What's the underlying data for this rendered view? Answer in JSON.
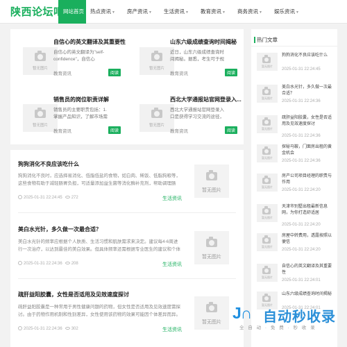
{
  "header": {
    "logo": "陕西论坛吧",
    "nav": [
      {
        "label": "网站首页",
        "active": true,
        "dropdown": false
      },
      {
        "label": "热点资讯",
        "active": false,
        "dropdown": true
      },
      {
        "label": "房产资讯",
        "active": false,
        "dropdown": true
      },
      {
        "label": "生活资讯",
        "active": false,
        "dropdown": true
      },
      {
        "label": "教育资讯",
        "active": false,
        "dropdown": true
      },
      {
        "label": "商务资讯",
        "active": false,
        "dropdown": true
      },
      {
        "label": "娱乐资讯",
        "active": false,
        "dropdown": true
      }
    ],
    "accent_color": "#1aaf5d"
  },
  "no_image_label": "暂无图片",
  "featured": [
    {
      "title": "自信心的英文翻译及其重要性",
      "desc": "自信心的英文翻译为\"self-confidence\"，自信心",
      "category": "教育资讯",
      "button": "阅读"
    },
    {
      "title": "山东六级成绩查询时间揭秘",
      "desc": "近日，山东六级成绩查询时间揭秘。据悉，考生可于规定时间内",
      "category": "教育资讯",
      "button": "阅读"
    },
    {
      "title": "销售员的岗位职责详解",
      "desc": "销售员的主要职责包括：1. 掌握产品知识，了解市场需求，为",
      "category": "教育资讯",
      "button": "阅读"
    },
    {
      "title": "西北大学通报站官网登录入...",
      "desc": "西北大学通报站官网登录入口是获得学习交流的途径，为广大学子",
      "category": "教育资讯",
      "button": "阅读"
    }
  ],
  "articles": [
    {
      "title": "狗狗消化不良应该吃什么",
      "desc": "狗狗消化不良时，应选择易消化、低脂低盐的食物，如白肉、稀饭、低脂狗粮等，这些食物有助于减轻肠胃负担，可适量添加益生菌等消化酶补充剂，帮助调理肠胃。",
      "date": "2025-01-31 22:24:45",
      "views": "272",
      "category": "生活资讯"
    },
    {
      "title": "美白水光针，多久做一次最合适？",
      "desc": "美白水光针的频率应根据个人肤质、生活习惯和肌肤需求来决定。建议每4-6周进行一次治疗，以达到最佳的美白效果。但具体频率还需根据专业医生的建议和个体情况。",
      "date": "2025-01-31 22:24:36",
      "views": "208",
      "category": "生活资讯"
    },
    {
      "title": "疏肝益阳胶囊，女性是否适用及见效速度探讨",
      "desc": "疏肝益阳胶囊是一种常用于男性健康问题的药物，但女性是否适用及见效速度需探讨。由于药物作用机制和性别差异，女性使用该药物的效果可能因个体差异而异。",
      "date": "2025-01-31 22:24:36",
      "views": "302",
      "category": "生活资讯"
    }
  ],
  "sidebar": {
    "title": "热门文章",
    "items": [
      {
        "title": "狗狗消化不良应该吃什么",
        "date": "2025-01-31 22:24:45"
      },
      {
        "title": "美白水光针，多久做一次最合适？",
        "date": "2025-01-31 22:24:36"
      },
      {
        "title": "疏肝益阳胶囊，女性是否适用及见效速度探讨",
        "date": "2025-01-31 22:24:36"
      },
      {
        "title": "探秘马鞍，门面房出租的黄金机会",
        "date": "2025-01-31 22:24:36"
      },
      {
        "title": "房产公司项目经理的职责与作用",
        "date": "2025-01-31 22:24:20"
      },
      {
        "title": "天津市别墅出租最新信息网，为你打造舒适居",
        "date": "2025-01-31 22:24:20"
      },
      {
        "title": "房屋中转费用，透露按照以便信",
        "date": "2025-01-31 22:24:20"
      },
      {
        "title": "自信心的英文翻译及其重要性",
        "date": "2025-01-31 22:24:01"
      },
      {
        "title": "山东六级成绩查询时间揭秘",
        "date": "2025-01-31 22:24:01"
      }
    ]
  },
  "watermark": {
    "logo": "J∩",
    "text": "自动秒收录",
    "sub": "全 自 动 · 免 费 · 秒 收 录"
  }
}
